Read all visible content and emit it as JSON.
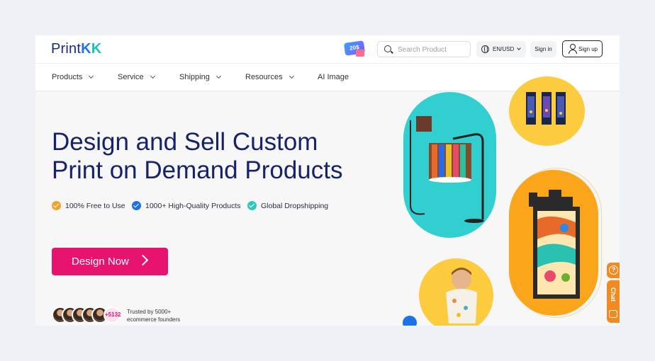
{
  "header": {
    "logo": {
      "part1": "Print",
      "part2": "K",
      "part3": "K"
    },
    "promo_badge": "20$",
    "search": {
      "placeholder": "Search Product",
      "value": ""
    },
    "locale": "EN/USD",
    "signin_label": "Sign in",
    "signup_label": "Sign up"
  },
  "nav": {
    "items": [
      {
        "label": "Products",
        "has_dropdown": true
      },
      {
        "label": "Service",
        "has_dropdown": true
      },
      {
        "label": "Shipping",
        "has_dropdown": true
      },
      {
        "label": "Resources",
        "has_dropdown": true
      },
      {
        "label": "AI Image",
        "has_dropdown": false
      }
    ]
  },
  "hero": {
    "title_line1": "Design and Sell Custom",
    "title_line2": "Print on Demand Products",
    "features": [
      {
        "label": "100% Free to Use",
        "color": "#f2a22b"
      },
      {
        "label": "1000+ High-Quality Products",
        "color": "#1d72e8"
      },
      {
        "label": "Global Dropshipping",
        "color": "#2ec7c0"
      }
    ],
    "cta_label": "Design Now",
    "trust": {
      "count": "+5132",
      "line1": "Trusted by 5000+",
      "line2": "ecommerce founders"
    }
  },
  "side_widget": {
    "help_icon": "question-icon",
    "chat_label": "Chat"
  },
  "colors": {
    "brand_navy": "#16236a",
    "brand_pink": "#e8136f",
    "teal": "#31cfd0",
    "yellow": "#fdcb3e",
    "orange": "#fba51a"
  }
}
